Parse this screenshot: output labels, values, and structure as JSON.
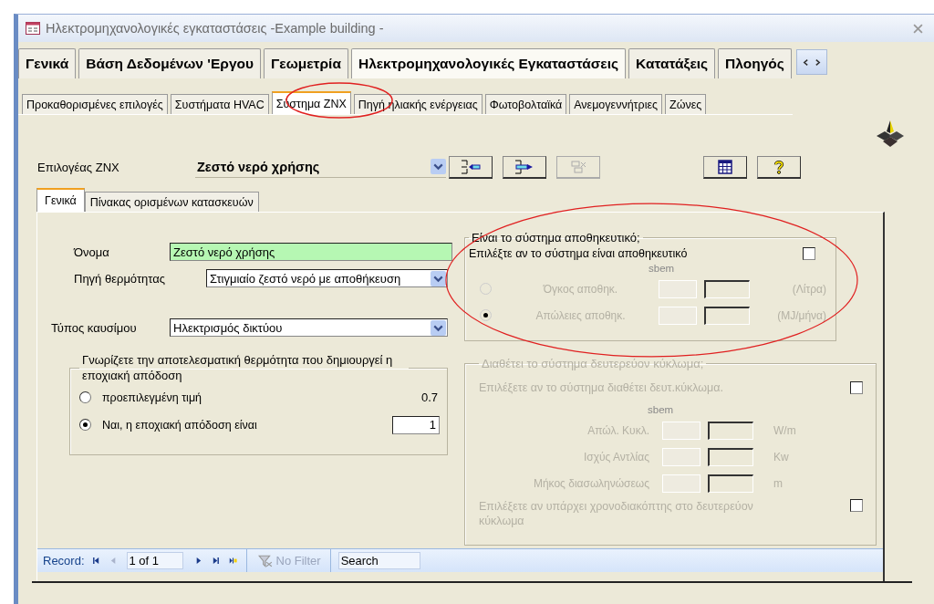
{
  "window": {
    "title": "Ηλεκτρομηχανολογικές εγκαταστάσεις -Example building -"
  },
  "main_tabs": [
    {
      "label": "Γενικά",
      "selected": false
    },
    {
      "label": "Βάση Δεδομένων 'Εργου",
      "selected": false
    },
    {
      "label": "Γεωμετρία",
      "selected": false
    },
    {
      "label": "Ηλεκτρομηχανολογικές Εγκαταστάσεις",
      "selected": true
    },
    {
      "label": "Κατατάξεις",
      "selected": false
    },
    {
      "label": "Πλοηγός",
      "selected": false
    }
  ],
  "sub_tabs": [
    {
      "label": "Προκαθορισμένες επιλογές",
      "selected": false
    },
    {
      "label": "Συστήματα HVAC",
      "selected": false
    },
    {
      "label": "Σύστημα ZNX",
      "selected": true
    },
    {
      "label": "Πηγή ηλιακής ενέργειας",
      "selected": false
    },
    {
      "label": "Φωτοβολταϊκά",
      "selected": false
    },
    {
      "label": "Ανεμογεννήτριες",
      "selected": false
    },
    {
      "label": "Ζώνες",
      "selected": false
    }
  ],
  "selector": {
    "label": "Επιλογέας ΖΝΧ",
    "value": "Ζεστό νερό χρήσης"
  },
  "toolbar_buttons": [
    {
      "kind": "insert",
      "disabled": false
    },
    {
      "kind": "append",
      "disabled": false
    },
    {
      "kind": "delete",
      "disabled": true
    },
    {
      "kind": "table",
      "disabled": false
    },
    {
      "kind": "help",
      "disabled": false
    }
  ],
  "inner_tabs": [
    {
      "label": "Γενικά",
      "selected": true
    },
    {
      "label": "Πίνακας ορισμένων κατασκευών",
      "selected": false
    }
  ],
  "name": {
    "label": "Όνομα",
    "value": "Ζεστό νερό χρήσης"
  },
  "heat_source": {
    "label": "Πηγή θερμότητας",
    "value": "Στιγμιαίο ζεστό νερό με αποθήκευση"
  },
  "fuel": {
    "label": "Τύπος καυσίμου",
    "value": "Ηλεκτρισμός δικτύου"
  },
  "efficiency_group": {
    "legend": "Γνωρίζετε την αποτελεσματική θερμότητα που δημιουργεί η εποχιακή απόδοση",
    "options": [
      {
        "label": "προεπιλεγμένη τιμή",
        "selected": false,
        "kind": "text",
        "value": "0.7"
      },
      {
        "label": "Ναι, η εποχιακή απόδοση είναι",
        "selected": true,
        "kind": "input",
        "value": "1"
      }
    ]
  },
  "storage_group": {
    "legend": "Είναι το σύστημα αποθηκευτικό;",
    "checkbox_label": "Επιλέξτε αν το σύστημα είναι αποθηκευτικό",
    "checked": false,
    "column_header": "sbem",
    "rows": [
      {
        "label": "Όγκος αποθηκ.",
        "unit": "(Λίτρα)",
        "selected": false,
        "disabled": true
      },
      {
        "label": "Απώλειες αποθηκ.",
        "unit": "(MJ/μήνα)",
        "selected": true,
        "disabled": true
      }
    ]
  },
  "secondary_group": {
    "legend": "Διαθέτει το σύστημα δευτερεύον κύκλωμα;",
    "disabled": true,
    "checkbox_label": "Επιλέξετε αν το σύστημα διαθέτει δευτ.κύκλωμα.",
    "checked": false,
    "column_header": "sbem",
    "rows": [
      {
        "label": "Απώλ. Κυκλ.",
        "unit": "W/m"
      },
      {
        "label": "Ισχύς Αντλίας",
        "unit": "Kw"
      },
      {
        "label": "Μήκος διασωληνώσεως",
        "unit": "m"
      }
    ],
    "timer_label": "Επιλέξετε αν υπάρχει χρονοδιακόπτης στο δευτερεύον κύκλωμα",
    "timer_checked": false
  },
  "record_nav": {
    "label": "Record:",
    "position": "1 of 1",
    "filter": "No Filter",
    "search_placeholder": "Search"
  }
}
